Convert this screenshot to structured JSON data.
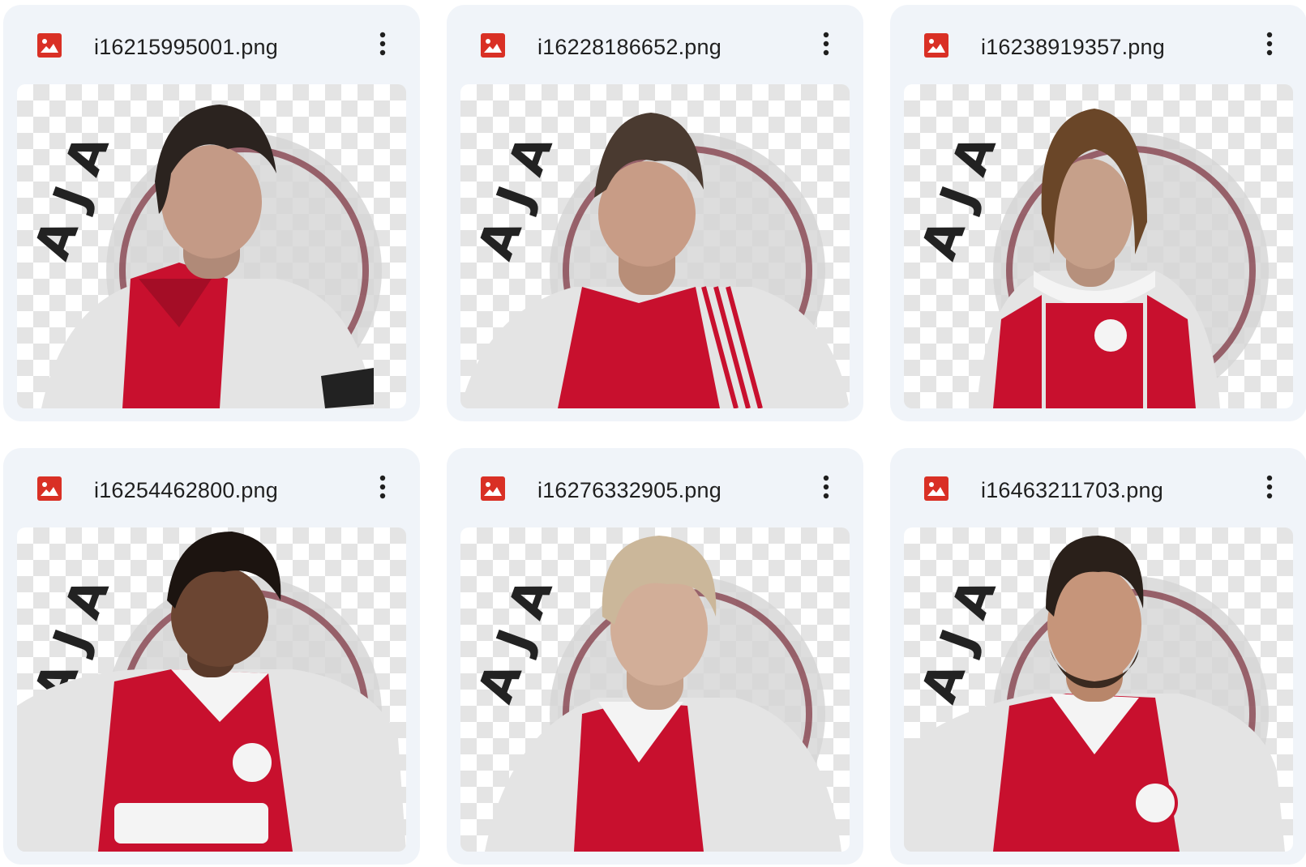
{
  "files": [
    {
      "name": "i16215995001.png",
      "icon": "image-file-icon",
      "menu_icon": "more-vert-icon",
      "thumbnail": "player-portrait-dark-curly-hair-red-collar"
    },
    {
      "name": "i16228186652.png",
      "icon": "image-file-icon",
      "menu_icon": "more-vert-icon",
      "thumbnail": "player-portrait-brown-hair-adidas-kit"
    },
    {
      "name": "i16238919357.png",
      "icon": "image-file-icon",
      "menu_icon": "more-vert-icon",
      "thumbnail": "player-portrait-long-hair-retro-kit"
    },
    {
      "name": "i16254462800.png",
      "icon": "image-file-icon",
      "menu_icon": "more-vert-icon",
      "thumbnail": "player-portrait-curly-hair-ziggo-kit"
    },
    {
      "name": "i16276332905.png",
      "icon": "image-file-icon",
      "menu_icon": "more-vert-icon",
      "thumbnail": "player-portrait-blond-hair-kit"
    },
    {
      "name": "i16463211703.png",
      "icon": "image-file-icon",
      "menu_icon": "more-vert-icon",
      "thumbnail": "player-portrait-beard-modern-kit"
    }
  ],
  "colors": {
    "card_background": "#f0f4f9",
    "image_icon_red": "#d93025",
    "text": "#1f1f1f",
    "kit_red": "#c8102e",
    "kit_white": "#e9e9e9",
    "crest_maroon": "#7a2e3a"
  }
}
